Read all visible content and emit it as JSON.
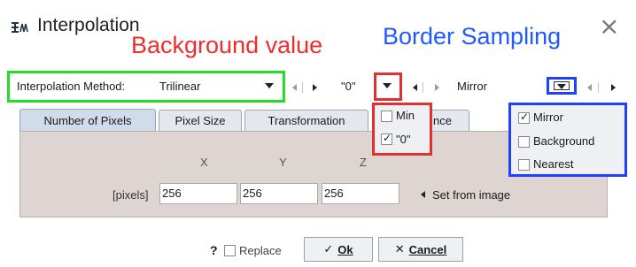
{
  "dialog": {
    "title": "Interpolation",
    "close_glyph": "×",
    "icon": "interpolation-icon"
  },
  "annotations": {
    "background_value": "Background value",
    "border_sampling": "Border Sampling",
    "colors": {
      "red": "#ef2d2d",
      "blue": "#1e5aff",
      "green": "#22dd22"
    }
  },
  "toolbar": {
    "method_label": "Interpolation Method:",
    "method_value": "Trilinear",
    "background_value": "\"0\"",
    "border_value": "Mirror"
  },
  "tabs": [
    {
      "label": "Number of Pixels",
      "active": true
    },
    {
      "label": "Pixel Size",
      "active": false
    },
    {
      "label": "Transformation",
      "active": false
    },
    {
      "label": "nce",
      "active": false
    }
  ],
  "pixels_panel": {
    "col_x": "X",
    "col_y": "Y",
    "col_z": "Z",
    "row_label": "[pixels]",
    "values": [
      "256",
      "256",
      "256"
    ],
    "set_from_image": "Set from image"
  },
  "footer": {
    "help": "?",
    "replace_label": "Replace",
    "replace_checked": false,
    "ok_glyph": "✓",
    "ok_label": "Ok",
    "cancel_glyph": "✕",
    "cancel_label": "Cancel"
  },
  "background_menu": {
    "items": [
      {
        "label": "Min",
        "checked": false
      },
      {
        "label": "\"0\"",
        "checked": true
      }
    ]
  },
  "border_menu": {
    "items": [
      {
        "label": "Mirror",
        "checked": true
      },
      {
        "label": "Background",
        "checked": false
      },
      {
        "label": "Nearest",
        "checked": false
      }
    ]
  }
}
